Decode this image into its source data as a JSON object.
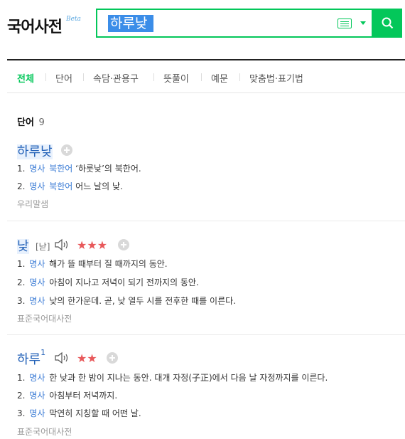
{
  "header": {
    "logo": "국어사전",
    "beta": "Beta",
    "search_value": "하루낮"
  },
  "tabs": [
    "전체",
    "단어",
    "속담·관용구",
    "뜻풀이",
    "예문",
    "맞춤법·표기법"
  ],
  "section": {
    "title": "단어",
    "count": "9"
  },
  "entries": [
    {
      "word": "하루낮",
      "defs": [
        {
          "num": "1.",
          "pos": "명사",
          "note": "북한어",
          "text": "‘하룻낮’의 북한어."
        },
        {
          "num": "2.",
          "pos": "명사",
          "note": "북한어",
          "text": "어느 날의 낮."
        }
      ],
      "source": "우리말샘"
    },
    {
      "word": "낮",
      "pron": "[낟]",
      "stars": "★★★",
      "defs": [
        {
          "num": "1.",
          "pos": "명사",
          "text": "해가 뜰 때부터 질 때까지의 동안."
        },
        {
          "num": "2.",
          "pos": "명사",
          "text": "아침이 지나고 저녁이 되기 전까지의 동안."
        },
        {
          "num": "3.",
          "pos": "명사",
          "text": "낮의 한가운데. 곧, 낮 열두 시를 전후한 때를 이른다."
        }
      ],
      "source": "표준국어대사전"
    },
    {
      "word": "하루",
      "sup": "1",
      "stars": "★★",
      "defs": [
        {
          "num": "1.",
          "pos": "명사",
          "text": "한 낮과 한 밤이 지나는 동안. 대개 자정(子正)에서 다음 날 자정까지를 이른다."
        },
        {
          "num": "2.",
          "pos": "명사",
          "text": "아침부터 저녁까지."
        },
        {
          "num": "3.",
          "pos": "명사",
          "text": "막연히 지칭할 때 어떤 날."
        }
      ],
      "source": "표준국어대사전"
    }
  ]
}
